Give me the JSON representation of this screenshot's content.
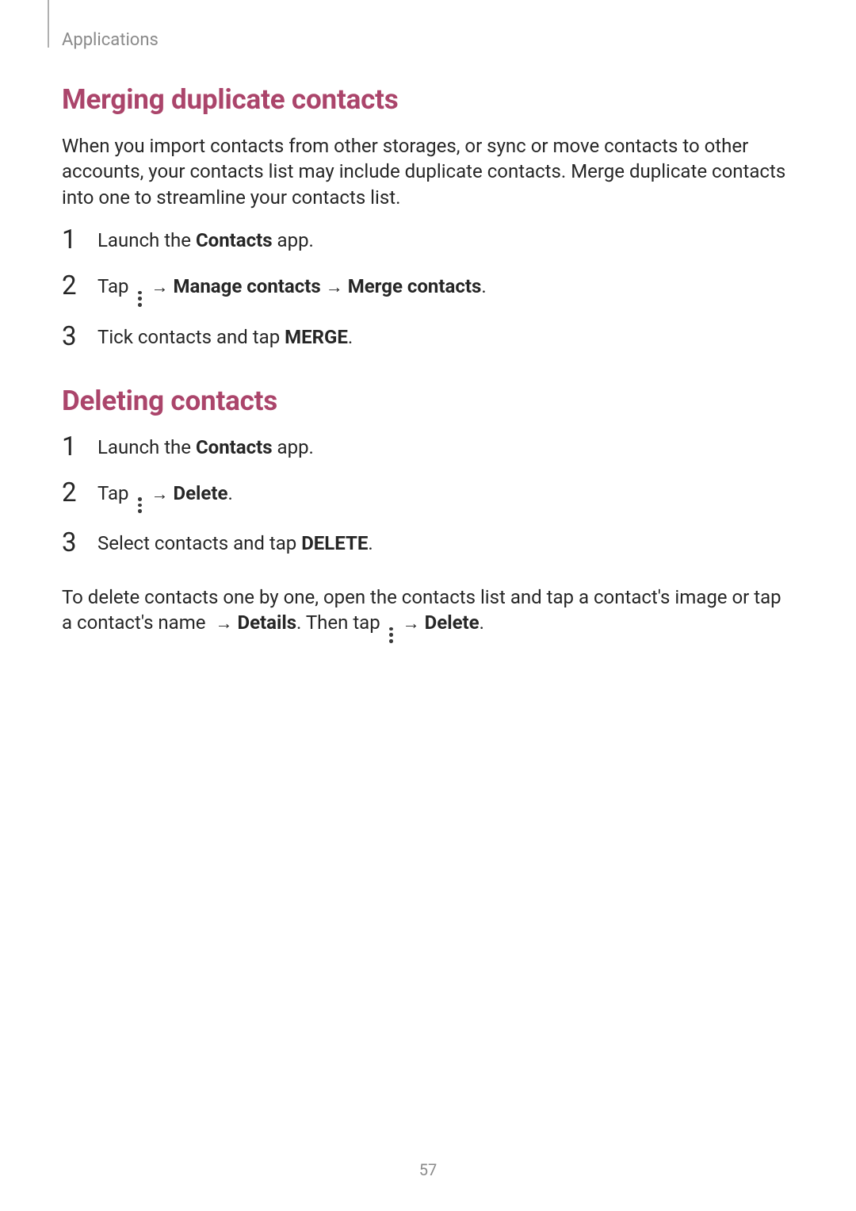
{
  "header": {
    "label": "Applications"
  },
  "page_number": "57",
  "section1": {
    "title": "Merging duplicate contacts",
    "intro": "When you import contacts from other storages, or sync or move contacts to other accounts, your contacts list may include duplicate contacts. Merge duplicate contacts into one to streamline your contacts list.",
    "step1_pre": "Launch the ",
    "step1_bold": "Contacts",
    "step1_post": " app.",
    "step2_pre": "Tap ",
    "step2_arrow1": "→",
    "step2_bold1": "Manage contacts",
    "step2_arrow2": "→",
    "step2_bold2": "Merge contacts",
    "step2_post": ".",
    "step3_pre": "Tick contacts and tap ",
    "step3_bold": "MERGE",
    "step3_post": "."
  },
  "section2": {
    "title": "Deleting contacts",
    "step1_pre": "Launch the ",
    "step1_bold": "Contacts",
    "step1_post": " app.",
    "step2_pre": "Tap ",
    "step2_arrow": "→",
    "step2_bold": "Delete",
    "step2_post": ".",
    "step3_pre": "Select contacts and tap ",
    "step3_bold": "DELETE",
    "step3_post": ".",
    "post_p1_a": "To delete contacts one by one, open the contacts list and tap a contact's image or tap a contact's name ",
    "post_arrow1": "→",
    "post_bold1": "Details",
    "post_p1_b": ". Then tap ",
    "post_arrow2": "→",
    "post_bold2": "Delete",
    "post_p1_c": "."
  }
}
